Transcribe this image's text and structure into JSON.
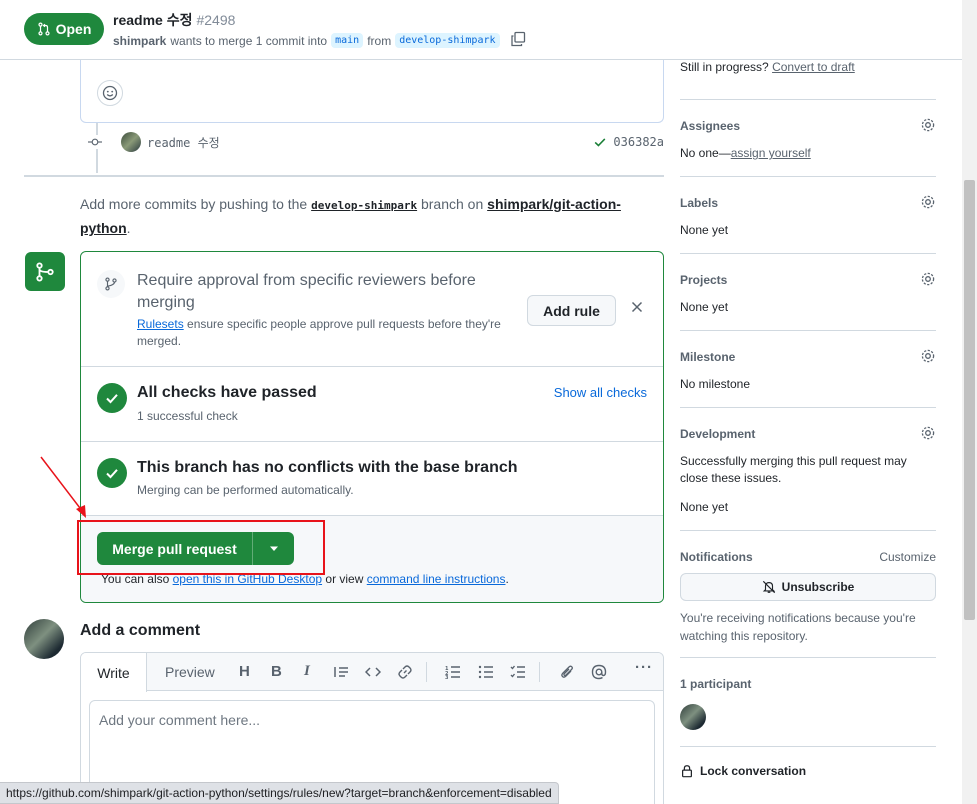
{
  "header": {
    "state": "Open",
    "title": "readme 수정",
    "number": "#2498",
    "author": "shimpark",
    "meta_text": "wants to merge 1 commit into",
    "base_branch": "main",
    "from_text": "from",
    "head_branch": "develop-shimpark"
  },
  "commit": {
    "message": "readme 수정",
    "sha": "036382a"
  },
  "push_hint": {
    "prefix": "Add more commits by pushing to the",
    "branch": "develop-shimpark",
    "middle": "branch on",
    "repo": "shimpark/git-action-python",
    "suffix": "."
  },
  "merge_box": {
    "rule_title": "Require approval from specific reviewers before merging",
    "rule_link": "Rulesets",
    "rule_desc": "ensure specific people approve pull requests before they're merged.",
    "add_rule": "Add rule",
    "checks_title": "All checks have passed",
    "checks_sub": "1 successful check",
    "show_checks": "Show all checks",
    "conflict_title": "This branch has no conflicts with the base branch",
    "conflict_sub": "Merging can be performed automatically.",
    "merge_button": "Merge pull request",
    "also_prefix": "You can also",
    "desktop_link": "open this in GitHub Desktop",
    "also_middle": "or view",
    "cli_link": "command line instructions",
    "also_suffix": "."
  },
  "comment": {
    "heading": "Add a comment",
    "tab_write": "Write",
    "tab_preview": "Preview",
    "placeholder": "Add your comment here..."
  },
  "status_url": "https://github.com/shimpark/git-action-python/settings/rules/new?target=branch&enforcement=disabled",
  "sidebar": {
    "draft_prefix": "Still in progress?",
    "draft_link": "Convert to draft",
    "assignees_h": "Assignees",
    "assignees_v": "No one—",
    "assign_link": "assign yourself",
    "labels_h": "Labels",
    "labels_v": "None yet",
    "projects_h": "Projects",
    "projects_v": "None yet",
    "milestone_h": "Milestone",
    "milestone_v": "No milestone",
    "development_h": "Development",
    "development_v": "Successfully merging this pull request may close these issues.",
    "development_v2": "None yet",
    "notifications_h": "Notifications",
    "customize": "Customize",
    "unsubscribe": "Unsubscribe",
    "notif_note": "You're receiving notifications because you're watching this repository.",
    "participants_h": "1 participant",
    "lock": "Lock conversation"
  },
  "colors": {
    "success": "#1f883d",
    "link": "#0969da",
    "highlight": "#e8131a"
  }
}
